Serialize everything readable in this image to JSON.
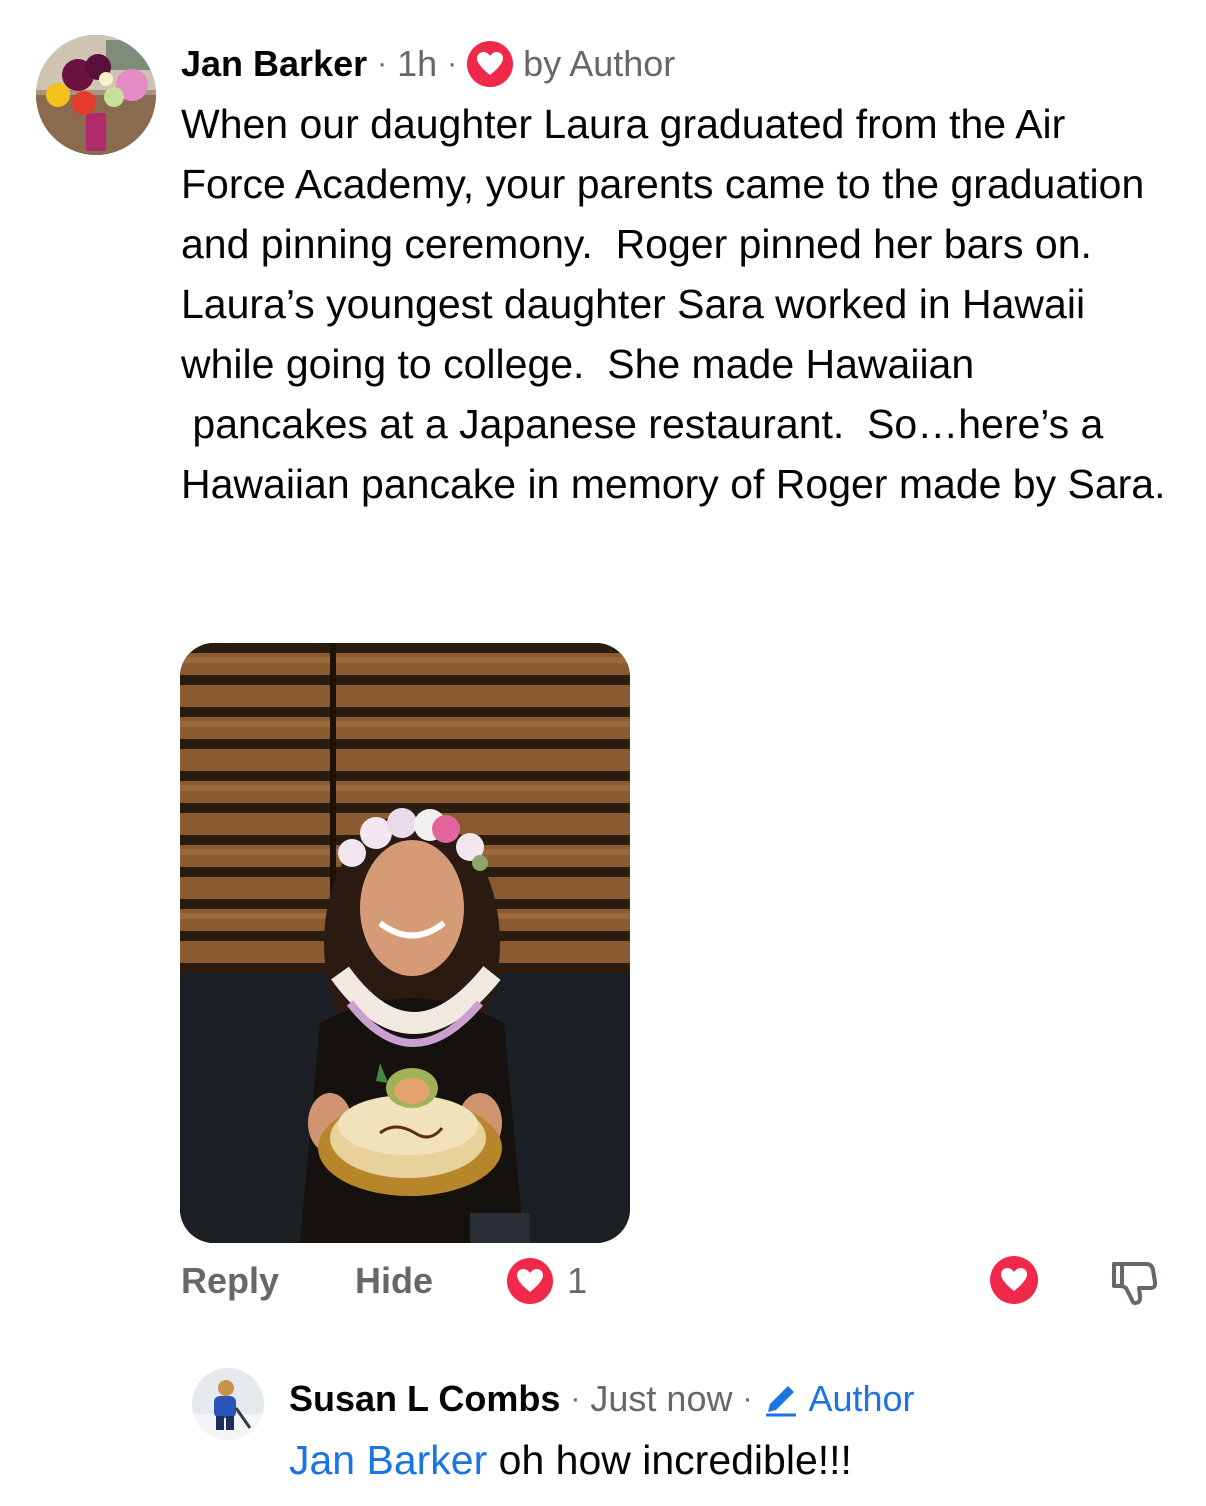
{
  "comment": {
    "author": "Jan Barker",
    "time": "1h",
    "badge_icon": "heart-icon",
    "badge_label": "by Author",
    "body": "When our daughter Laura graduated from the Air Force Academy, your parents came to the graduation and pinning ceremony.  Roger pinned her bars on.  Laura’s youngest daughter Sara worked in Hawaii while going to college.  She made Hawaiian\n pancakes at a Japanese restaurant.  So…here’s a Hawaiian pancake in memory of Roger made by Sara.",
    "actions": {
      "reply": "Reply",
      "hide": "Hide",
      "reaction_count": "1"
    }
  },
  "reply": {
    "author": "Susan L Combs",
    "time": "Just now",
    "badge_label": "Author",
    "mention": "Jan Barker",
    "text": " oh how incredible!!!"
  },
  "colors": {
    "heart_red": "#f0284a",
    "link_blue": "#1b74e4",
    "meta_gray": "#65676b"
  }
}
